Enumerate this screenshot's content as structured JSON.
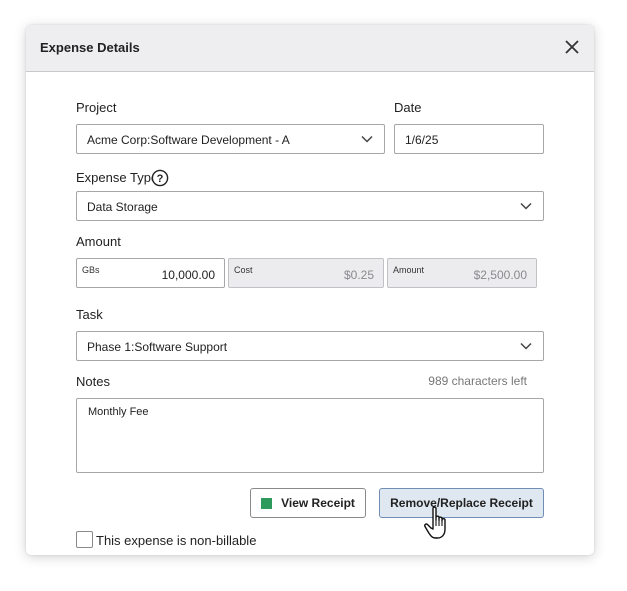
{
  "dialog": {
    "title": "Expense Details"
  },
  "project": {
    "label": "Project",
    "value": "Acme Corp:Software Development - A"
  },
  "date": {
    "label": "Date",
    "value": "1/6/25"
  },
  "expense_type": {
    "label": "Expense Type",
    "value": "Data Storage"
  },
  "amount": {
    "label": "Amount",
    "quantity_caption": "GBs",
    "quantity_value": "10,000.00",
    "cost_caption": "Cost",
    "cost_value": "$0.25",
    "total_caption": "Amount",
    "total_value": "$2,500.00"
  },
  "task": {
    "label": "Task",
    "value": "Phase 1:Software Support"
  },
  "notes": {
    "label": "Notes",
    "chars_left": "989 characters left",
    "value": "Monthly Fee"
  },
  "buttons": {
    "view_receipt": "View Receipt",
    "replace_receipt": "Remove/Replace Receipt"
  },
  "non_billable": {
    "label": "This expense is non-billable",
    "checked": false
  },
  "colors": {
    "header_bg": "#eeeef0",
    "receipt_indicator": "#2e9a5c",
    "primary_button_bg": "#dfe7f1",
    "primary_button_border": "#6f8db5"
  },
  "icons": [
    "close-icon",
    "chevron-down-icon",
    "help-icon",
    "receipt-indicator-icon",
    "hand-cursor-icon"
  ]
}
